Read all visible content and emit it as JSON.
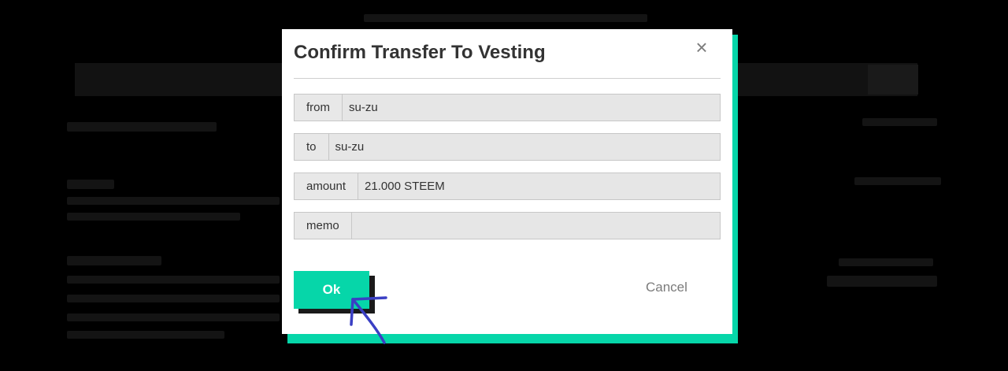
{
  "modal": {
    "title": "Confirm Transfer To Vesting",
    "close_icon": "close-icon",
    "fields": [
      {
        "label": "from",
        "value": "su-zu"
      },
      {
        "label": "to",
        "value": "su-zu"
      },
      {
        "label": "amount",
        "value": "21.000 STEEM"
      },
      {
        "label": "memo",
        "value": ""
      }
    ],
    "ok_label": "Ok",
    "cancel_label": "Cancel"
  },
  "annotation": {
    "icon": "hand-drawn-arrow-icon",
    "color": "#3a3fc4"
  },
  "colors": {
    "accent": "#06d6a9",
    "overlay": "#000000"
  }
}
